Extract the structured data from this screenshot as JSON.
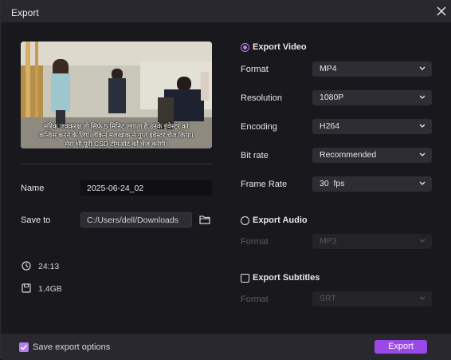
{
  "window": {
    "title": "Export"
  },
  "preview": {
    "subtitle_lines": [
      "मॉरेक जवकरक्ष तो सिर्फ 5 मिनिट लगाता है उनके इंवेस्टर को",
      "कन्विंस करने के लिए।लेकिन मलखाक ने गुप्त इंवेस्टर चेंज किया।",
      "मेरा भी पूरी CSD टीमऑट को चेंज करेगी।"
    ]
  },
  "left": {
    "name_label": "Name",
    "name_value": "2025-06-24_02",
    "save_label": "Save to",
    "save_path": "C:/Users/dell/Downloads",
    "duration": "24:13",
    "size": "1.4GB"
  },
  "export_video": {
    "title": "Export Video",
    "selected": true,
    "rows": [
      {
        "label": "Format",
        "value": "MP4"
      },
      {
        "label": "Resolution",
        "value": "1080P"
      },
      {
        "label": "Encoding",
        "value": "H264"
      },
      {
        "label": "Bit rate",
        "value": "Recommended"
      },
      {
        "label": "Frame Rate",
        "value": "30  fps"
      }
    ]
  },
  "export_audio": {
    "title": "Export Audio",
    "selected": false,
    "format_label": "Format",
    "format_value": "MP3"
  },
  "export_subtitles": {
    "title": "Export Subtitles",
    "checked": false,
    "format_label": "Format",
    "format_value": "SRT"
  },
  "footer": {
    "save_options_label": "Save export options",
    "save_options_checked": true,
    "export_button": "Export"
  },
  "colors": {
    "accent": "#b57cf4",
    "button": "#9a48e8",
    "background": "#19191d"
  }
}
